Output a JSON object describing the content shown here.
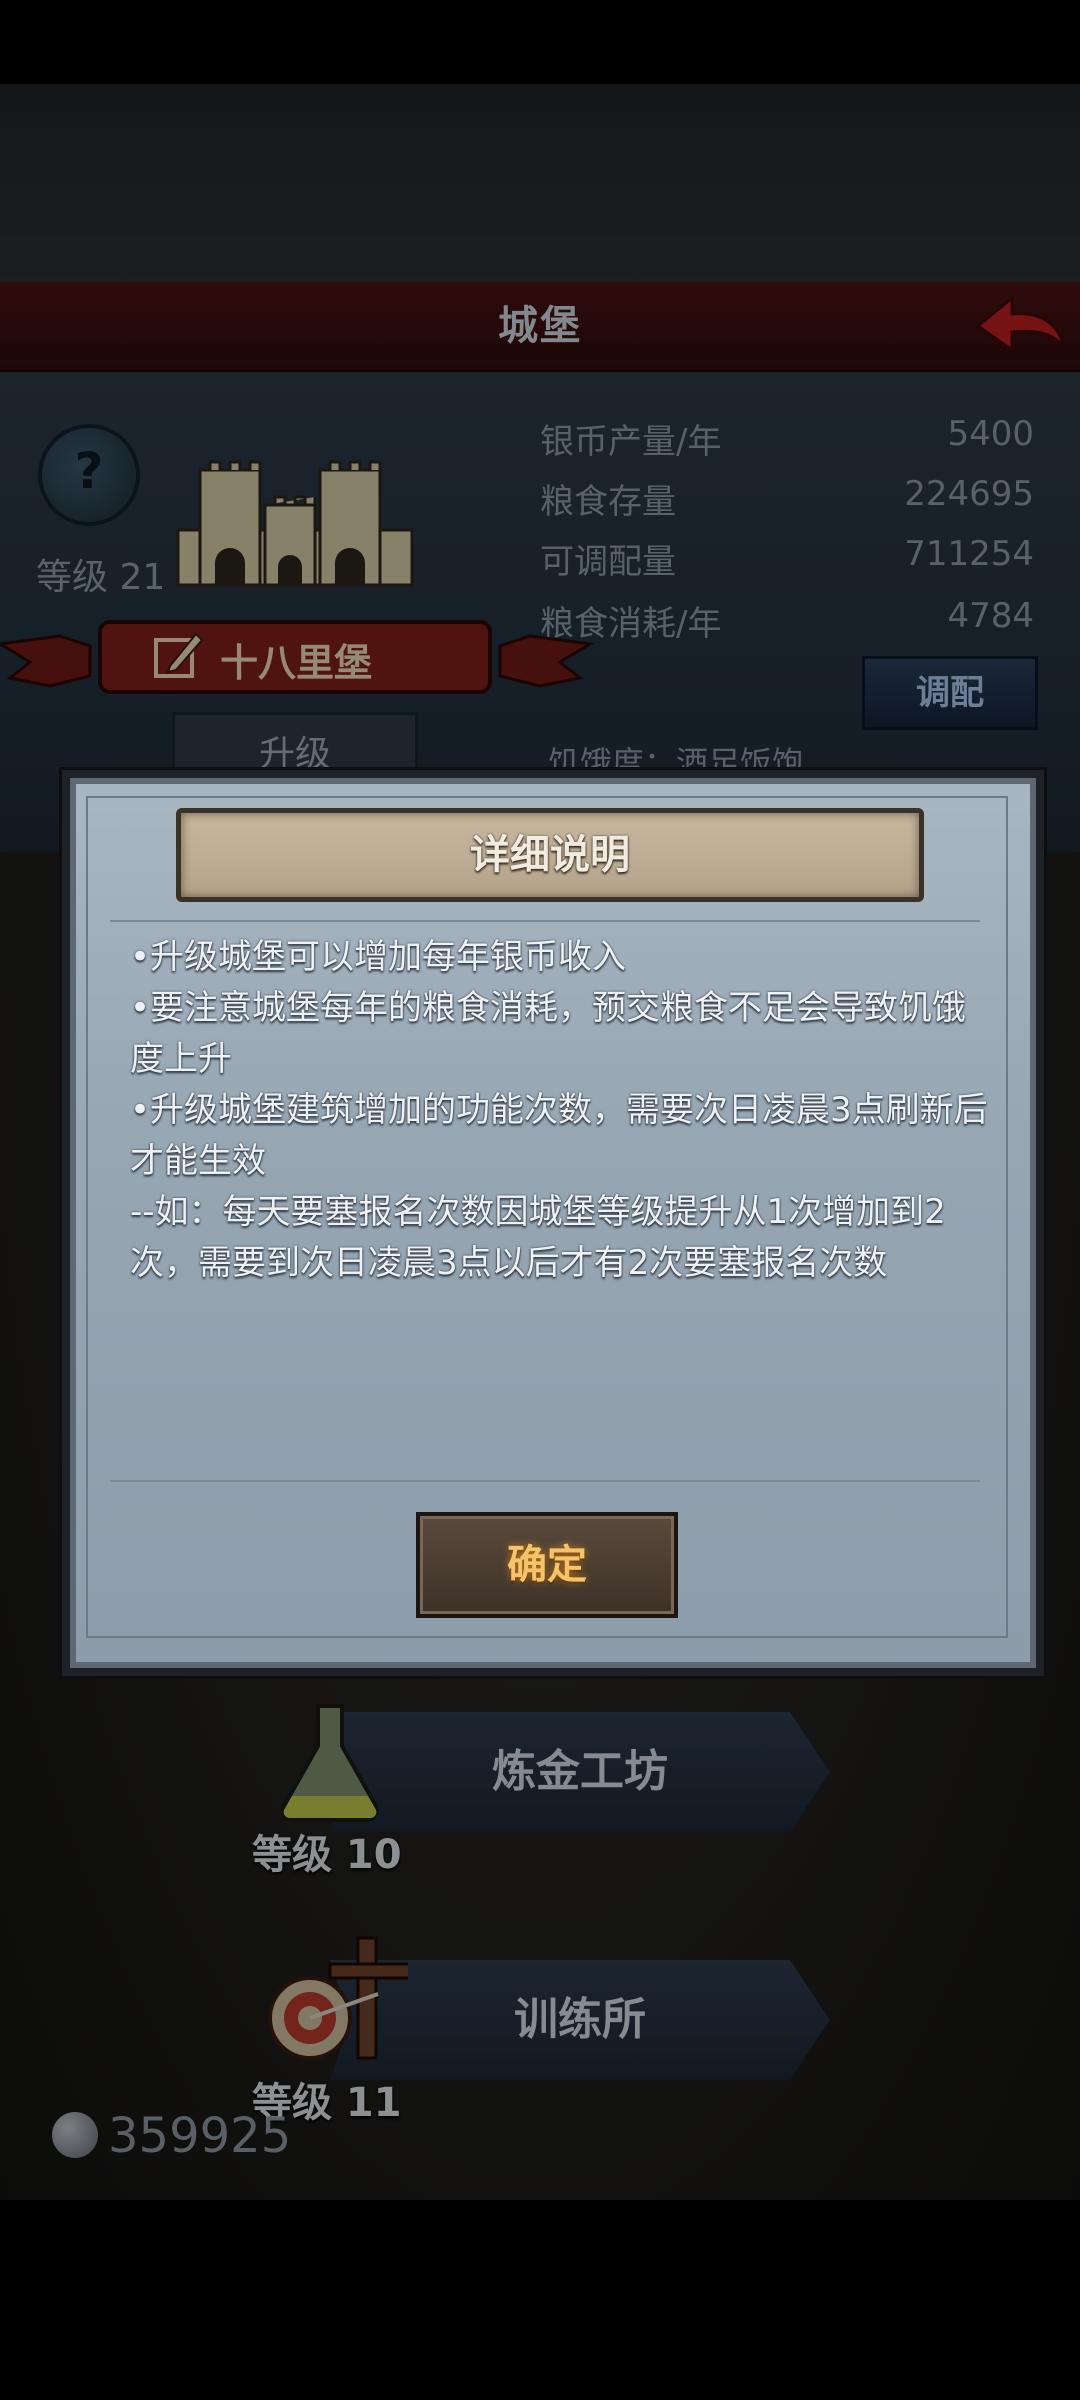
{
  "header": {
    "title": "城堡"
  },
  "castle_info": {
    "level_label": "等级 21",
    "name": "十八里堡",
    "stats": [
      {
        "label": "银币产量/年",
        "value": "5400"
      },
      {
        "label": "粮食存量",
        "value": "224695"
      },
      {
        "label": "可调配量",
        "value": "711254"
      },
      {
        "label": "粮食消耗/年",
        "value": "4784"
      }
    ],
    "adjust_label": "调配",
    "upgrade_label": "升级",
    "hunger_text": "饥饿度：酒足饭饱"
  },
  "buildings": [
    {
      "name": "炼金工坊",
      "level": "等级 10"
    },
    {
      "name": "训练所",
      "level": "等级 11"
    }
  ],
  "currency": {
    "silver": "359925"
  },
  "modal": {
    "title": "详细说明",
    "lines": [
      "•升级城堡可以增加每年银币收入",
      "•要注意城堡每年的粮食消耗，预交粮食不足会导致饥饿度上升",
      "•升级城堡建筑增加的功能次数，需要次日凌晨3点刷新后才能生效",
      "--如：每天要塞报名次数因城堡等级提升从1次增加到2次，需要到次日凌晨3点以后才有2次要塞报名次数"
    ],
    "confirm_label": "确定"
  },
  "colors": {
    "header": "#4a1212",
    "modal_bg": "#a9b7c3",
    "confirm_text": "#f4c36b"
  }
}
